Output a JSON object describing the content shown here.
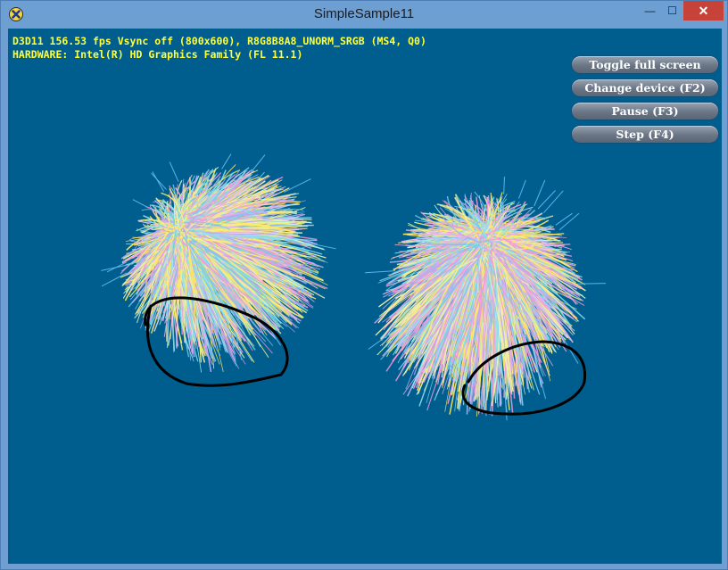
{
  "window": {
    "title": "SimpleSample11",
    "min_glyph": "—",
    "max_glyph": "☐",
    "close_glyph": "✕"
  },
  "stats": {
    "line1": "D3D11 156.53 fps Vsync off (800x600), R8G8B8A8_UNORM_SRGB (MS4, Q0)",
    "line2": "HARDWARE: Intel(R) HD Graphics Family (FL 11.1)"
  },
  "buttons": {
    "toggle_full_screen": "Toggle full screen",
    "change_device": "Change device (F2)",
    "pause": "Pause (F3)",
    "step": "Step (F4)"
  },
  "colors": {
    "client_bg": "#005e8f",
    "stats_text": "#ffff3c",
    "hair": [
      "#f5f078",
      "#8fe0f0",
      "#f49ad8",
      "#b7a8f0",
      "#f0f0a8",
      "#6fd0e8",
      "#e8b0e8",
      "#ffe860"
    ],
    "annotation": "#000000"
  }
}
